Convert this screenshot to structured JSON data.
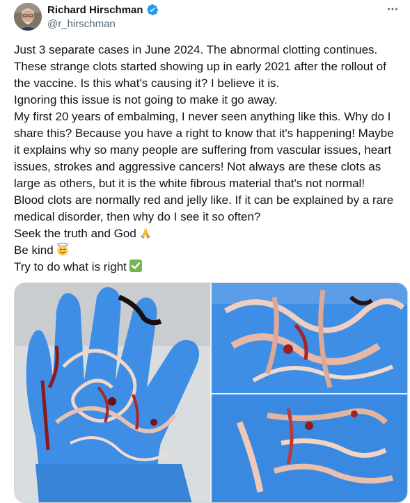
{
  "author": {
    "display_name": "Richard Hirschman",
    "handle": "@r_hirschman",
    "verified": true
  },
  "post": {
    "lines": [
      "Just 3 separate cases in June 2024. The abnormal clotting continues.",
      "These strange clots started showing up in early 2021 after the rollout of",
      "the vaccine. Is this what's causing it? I believe it is.",
      "Ignoring this issue is not going to make it go away.",
      "My first 20 years of embalming, I never seen anything like this. Why do I",
      "share this? Because you have a right to know that it's happening! Maybe",
      "it explains why so many people are suffering from vascular issues, heart",
      "issues, strokes and aggressive cancers! Not always are these clots as",
      "large as others, but it is the white fibrous material that's not normal!",
      "Blood clots are normally red and jelly like. If it can be explained by a rare",
      "medical disorder, then why do I see it so often?",
      "Seek the truth and God",
      "Be kind",
      "Try to do what is right"
    ],
    "emojis": {
      "line_12": "folded-hands-emoji",
      "line_13": "smiling-face-with-halo-emoji",
      "line_14": "check-mark-button-emoji"
    }
  },
  "media": {
    "count": 3,
    "images": [
      "gloved-hand-with-clots-photo",
      "clots-on-glove-closeup-photo",
      "clot-strands-on-glove-photo"
    ]
  },
  "colors": {
    "verified_blue": "#1d9bf0",
    "handle_gray": "#536471",
    "glove_blue": "#3f8ee6"
  }
}
